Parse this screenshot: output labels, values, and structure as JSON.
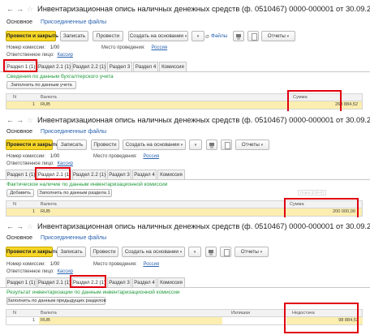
{
  "panel1": {
    "title": "Инвентаризационная опись наличных денежных средств (ф. 0510467) 0000-000001 от 30.09.2025 10:44:51 *",
    "links": {
      "main": "Основное",
      "files": "Присоединенные файлы"
    },
    "toolbar": {
      "post_close": "Провести и закрыть",
      "save": "Записать",
      "post": "Провести",
      "create_based": "Создать на основании",
      "files": "Файлы",
      "reports": "Отчеты"
    },
    "fields": {
      "commission_label": "Номер комиссии:",
      "commission_value": "1/00",
      "place_label": "Место проведения:",
      "place_value": "Россия",
      "responsible_label": "Ответственное лицо:",
      "responsible_value": "Кассир"
    },
    "tabs": [
      "Раздел 1 (1)",
      "Раздел 2.1 (1)",
      "Раздел 2.2 (1)",
      "Раздел 3",
      "Раздел 4",
      "Комиссия"
    ],
    "section_title": "Сведения по данным бухгалтерского учета",
    "fill_button": "Заполнить по данным учета",
    "table": {
      "col_n": "N",
      "col_currency": "Валюта",
      "col_sum": "Сумма",
      "row": {
        "n": "1",
        "currency": "RUB",
        "sum": "268 884,52"
      }
    }
  },
  "panel2": {
    "title": "Инвентаризационная опись наличных денежных средств (ф. 0510467) 0000-000001 от 30.09.2025 10:44:51 *",
    "links": {
      "main": "Основное",
      "files": "Присоединенные файлы"
    },
    "toolbar": {
      "post_close": "Провести и закрыть",
      "save": "Записать",
      "post": "Провести",
      "create_based": "Создать на основании",
      "reports": "Отчеты"
    },
    "fields": {
      "commission_label": "Номер комиссии:",
      "commission_value": "1/00",
      "place_label": "Место проведения:",
      "place_value": "Россия",
      "responsible_label": "Ответственное лицо:",
      "responsible_value": "Кассир"
    },
    "tabs": [
      "Раздел 1 (1)",
      "Раздел 2.1 (1)",
      "Раздел 2.2 (1)",
      "Раздел 3",
      "Раздел 4",
      "Комиссия"
    ],
    "section_title": "Фактическое наличие по данным инвентаризационной комиссии",
    "add_button": "Добавить",
    "fill_button": "Заполнить по данным раздела 1",
    "search_placeholder": "Поиск (Ctrl+F)",
    "table": {
      "col_n": "N",
      "col_currency": "Валюта",
      "col_sum": "Сумма",
      "row": {
        "n": "1",
        "currency": "RUB",
        "sum": "200 000,00"
      }
    }
  },
  "panel3": {
    "title": "Инвентаризационная опись наличных денежных средств (ф. 0510467) 0000-000001 от 30.09.2025 10:44:51 *",
    "links": {
      "main": "Основное",
      "files": "Присоединенные файлы"
    },
    "toolbar": {
      "post_close": "Провести и закрыть",
      "save": "Записать",
      "post": "Провести",
      "create_based": "Создать на основании",
      "reports": "Отчеты"
    },
    "fields": {
      "commission_label": "Номер комиссии:",
      "commission_value": "1/00",
      "place_label": "Место проведения:",
      "place_value": "Россия",
      "responsible_label": "Ответственное лицо:",
      "responsible_value": "Кассир"
    },
    "tabs": [
      "Раздел 1 (1)",
      "Раздел 2.1 (1)",
      "Раздел 2.2 (1)",
      "Раздел 3",
      "Раздел 4",
      "Комиссия"
    ],
    "section_title": "Результат инвентаризации по данным инвентаризационной комиссии",
    "fill_button": "Заполнить по данным предыдущих разделов",
    "table": {
      "col_n": "N",
      "col_currency": "Валюта",
      "col_surplus": "Излишки",
      "col_shortage": "Недостача",
      "row": {
        "n": "1",
        "currency": "RUB",
        "surplus": "",
        "shortage": "98 884,52"
      }
    }
  }
}
